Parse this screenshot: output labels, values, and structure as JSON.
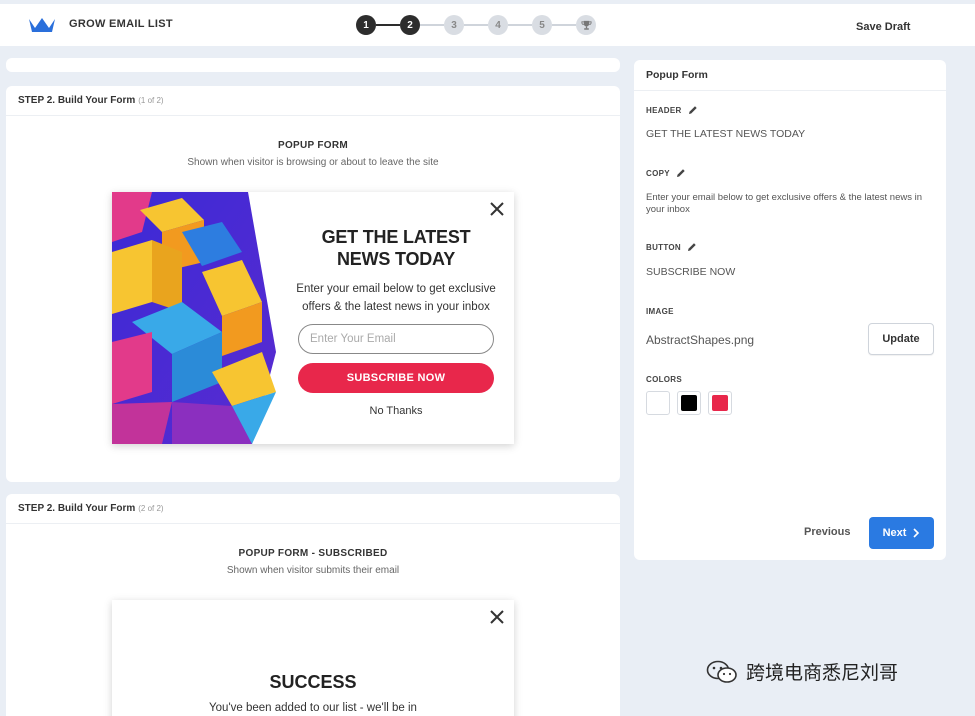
{
  "app": {
    "title": "GROW EMAIL LIST",
    "save_draft": "Save Draft"
  },
  "stepper": {
    "steps": [
      "1",
      "2",
      "3",
      "4",
      "5"
    ],
    "current_step": 2,
    "final_icon": "trophy-icon"
  },
  "steps_section": [
    {
      "heading": "STEP 2. Build Your Form",
      "sub": "(1 of 2)",
      "title": "POPUP FORM",
      "description": "Shown when visitor is browsing or about to leave the site"
    },
    {
      "heading": "STEP 2. Build Your Form",
      "sub": "(2 of 2)",
      "title": "POPUP FORM - SUBSCRIBED",
      "description": "Shown when visitor submits their email"
    }
  ],
  "popup": {
    "header_line1": "GET THE LATEST",
    "header_line2": "NEWS TODAY",
    "copy": "Enter your email below to get exclusive offers & the latest news in your inbox",
    "email_placeholder": "Enter Your Email",
    "button": "SUBSCRIBE NOW",
    "no_thanks": "No Thanks"
  },
  "success": {
    "title": "SUCCESS",
    "copy": "You've been added to our list - we'll be in"
  },
  "panel": {
    "title": "Popup Form",
    "header_label": "HEADER",
    "header_value": "GET THE LATEST NEWS TODAY",
    "copy_label": "COPY",
    "copy_value": "Enter your email below to get exclusive offers & the latest news in your inbox",
    "button_label": "BUTTON",
    "button_value": "SUBSCRIBE NOW",
    "image_label": "IMAGE",
    "image_value": "AbstractShapes.png",
    "update": "Update",
    "colors_label": "COLORS",
    "colors": [
      "#ffffff",
      "#000000",
      "#e8274b"
    ],
    "previous": "Previous",
    "next": "Next"
  },
  "watermark": "跨境电商悉尼刘哥",
  "theme": {
    "accent": "#2a7ae2",
    "cta": "#e8274b",
    "logo": "#2a6fdb"
  }
}
